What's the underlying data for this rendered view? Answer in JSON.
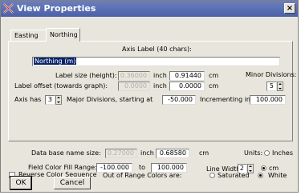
{
  "window": {
    "title": "View Properties",
    "close_label": "×"
  },
  "tabs": [
    {
      "label": "Easting"
    },
    {
      "label": "Northing"
    }
  ],
  "axis_label": {
    "caption": "Axis Label (40 chars):",
    "value": "Northing (m)"
  },
  "label_size": {
    "label": "Label size (height):",
    "inch_value": "0.36000",
    "inch_unit": "inch",
    "cm_value": "0.91440",
    "cm_unit": "cm"
  },
  "label_offset": {
    "label": "Label offset (towards graph):",
    "inch_value": "0.0000",
    "inch_unit": "inch",
    "cm_value": "0.0000",
    "cm_unit": "cm"
  },
  "minor_divisions": {
    "label": "Minor Divisions:",
    "value": "5"
  },
  "axis_has": {
    "label": "Axis has",
    "value": "3",
    "major_label": "Major Divisions, starting at",
    "start_value": "-50.000",
    "increment_label": "Incrementing in",
    "increment_value": "100.000"
  },
  "data_base_name_size": {
    "label": "Data base name size:",
    "inch_value": "0.27000",
    "inch_unit": "inch",
    "cm_value": "0.68580",
    "cm_unit": "cm"
  },
  "units": {
    "label": "Units:",
    "inches_label": "Inches",
    "cm_label": "cm",
    "selected": "cm"
  },
  "field_color_fill_range": {
    "label": "Field Color Fill Range:",
    "from_value": "-100.000",
    "to_label": "to",
    "to_value": "100.000"
  },
  "line_width": {
    "label": "Line Width:",
    "value": "2"
  },
  "reverse_color_sequence": {
    "label": "Reverse Color Sequence",
    "checked": false
  },
  "out_of_range": {
    "label": "Out of Range Colors are:",
    "saturated_label": "Saturated",
    "white_label": "White",
    "selected": "White"
  },
  "buttons": {
    "ok_label": "OK",
    "cancel_label": "Cancel"
  }
}
